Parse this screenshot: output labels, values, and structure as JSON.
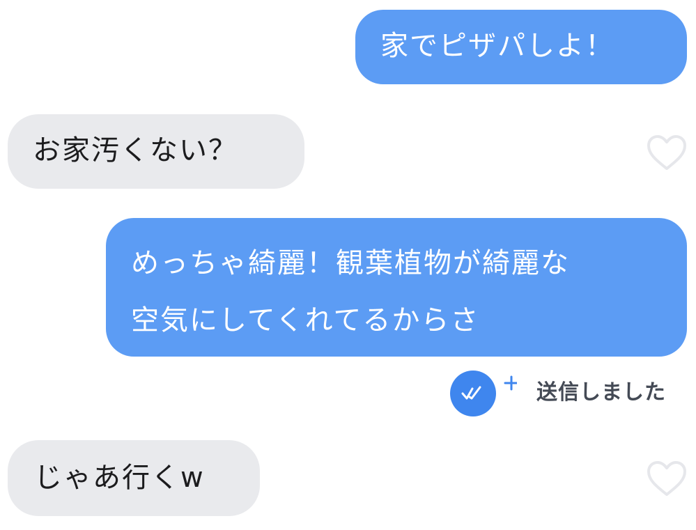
{
  "messages": [
    {
      "id": "msg1",
      "direction": "sent",
      "text": "家でピザパしよ！"
    },
    {
      "id": "msg2",
      "direction": "received",
      "text": "お家汚くない？"
    },
    {
      "id": "msg3",
      "direction": "sent",
      "lines": [
        "めっちゃ綺麗！観葉植物が綺麗な",
        "空気にしてくれてるからさ"
      ]
    },
    {
      "id": "msg4",
      "direction": "received",
      "text": "じゃあ行くw"
    }
  ],
  "status": {
    "text": "送信しました",
    "icon": "double-check-icon",
    "add_icon": "plus-icon"
  },
  "reactions": {
    "icon": "heart-outline-icon"
  },
  "colors": {
    "sent_bubble": "#5c9cf4",
    "received_bubble": "#e9eaed",
    "status_badge": "#3f86ee",
    "heart_outline": "#e6e7eb"
  }
}
